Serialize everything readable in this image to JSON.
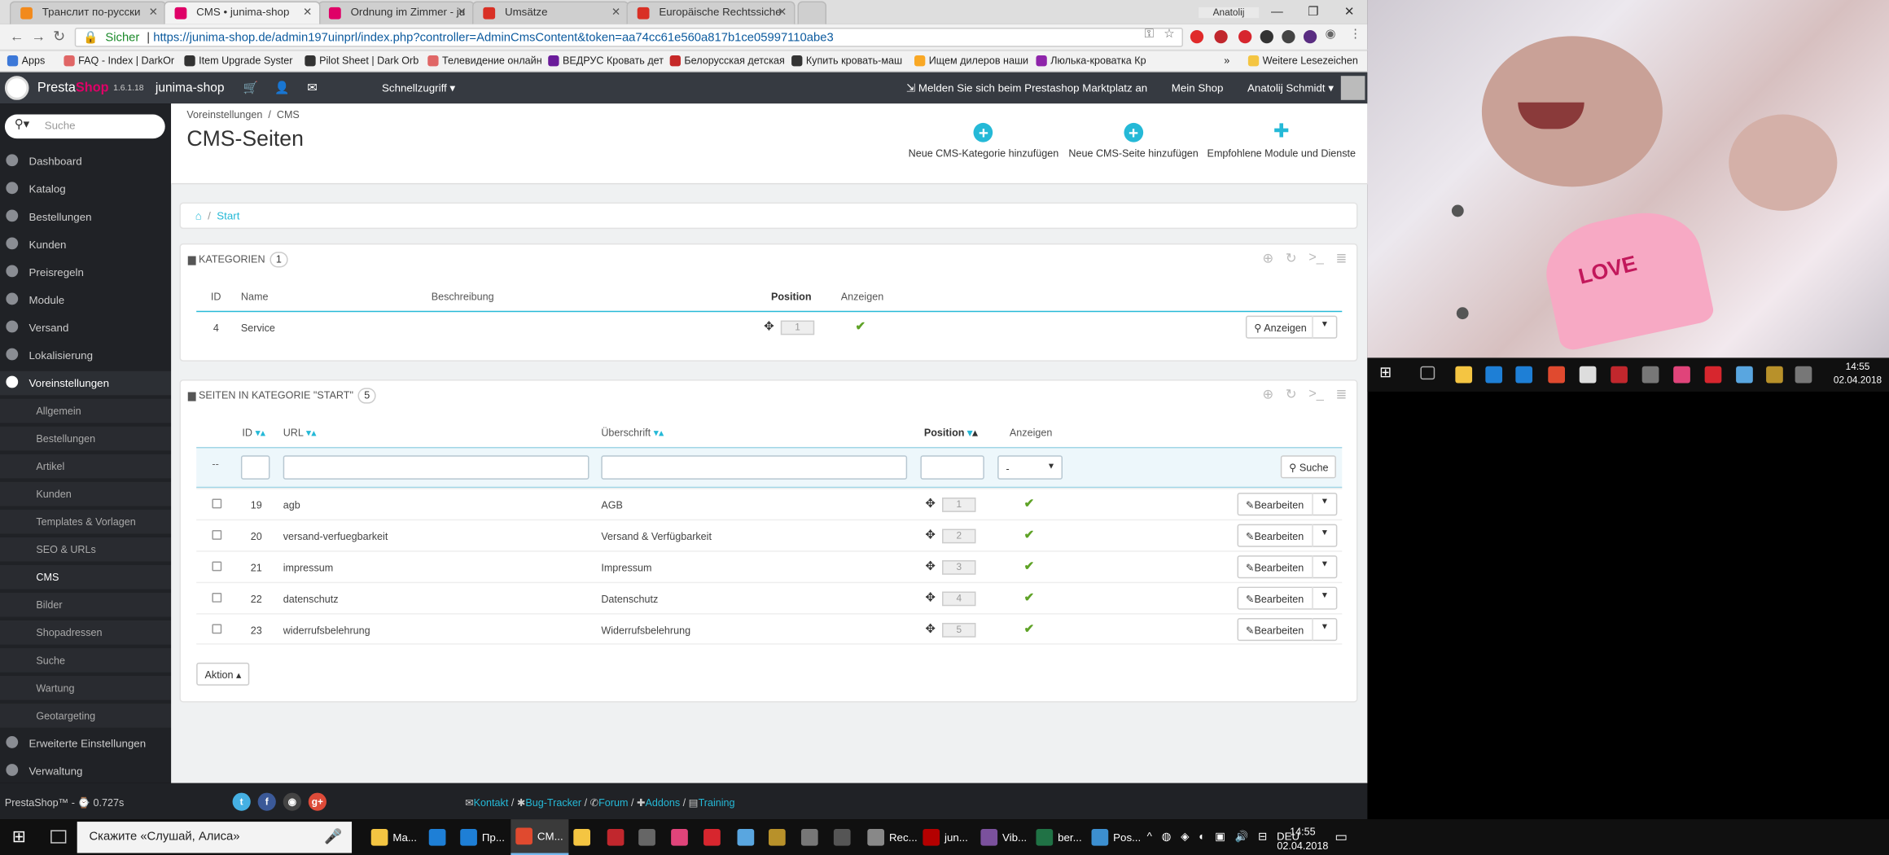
{
  "browser": {
    "tabs": [
      {
        "title": "Транслит по-русски",
        "color": "#f28a1c"
      },
      {
        "title": "CMS • junima-shop",
        "color": "#df0067"
      },
      {
        "title": "Ordnung im Zimmer - ju",
        "color": "#df0067"
      },
      {
        "title": "Umsätze",
        "color": "#d93025"
      },
      {
        "title": "Europäische Rechtssiche",
        "color": "#d93025"
      }
    ],
    "profile": "Anatolij",
    "security_label": "Sicher",
    "url": "https://junima-shop.de/admin197uinprl/index.php?controller=AdminCmsContent&token=aa74cc61e560a817b1ce05997110abe3",
    "bookmarks": [
      "Apps",
      "FAQ - Index | DarkOr",
      "Item Upgrade Syster",
      "Pilot Sheet | Dark Orb",
      "Телевидение онлайн",
      "ВЕДРУС Кровать дет",
      "Белорусская детская",
      "Купить кровать-маш",
      "Ищем дилеров наши",
      "Люлька-кроватка Кр"
    ],
    "bookmarks_more": "»",
    "other_bookmarks": "Weitere Lesezeichen"
  },
  "header": {
    "brand_a": "Presta",
    "brand_b": "Shop",
    "version": "1.6.1.18",
    "shop": "junima-shop",
    "quick_access": "Schnellzugriff ▾",
    "marketplace": "Melden Sie sich beim Prestashop Marktplatz an",
    "my_shop": "Mein Shop",
    "user": "Anatolij Schmidt ▾"
  },
  "sidebar": {
    "search_placeholder": "Suche",
    "items": [
      "Dashboard",
      "Katalog",
      "Bestellungen",
      "Kunden",
      "Preisregeln",
      "Module",
      "Versand",
      "Lokalisierung",
      "Voreinstellungen"
    ],
    "subitems": [
      "Allgemein",
      "Bestellungen",
      "Artikel",
      "Kunden",
      "Templates & Vorlagen",
      "SEO & URLs",
      "CMS",
      "Bilder",
      "Shopadressen",
      "Suche",
      "Wartung",
      "Geotargeting"
    ],
    "bottom_items": [
      "Erweiterte Einstellungen",
      "Verwaltung"
    ]
  },
  "page": {
    "breadcrumb_1": "Voreinstellungen",
    "breadcrumb_sep": "/",
    "breadcrumb_2": "CMS",
    "title": "CMS-Seiten",
    "toolbar": {
      "new_category": "Neue CMS-Kategorie hinzufügen",
      "new_page": "Neue CMS-Seite hinzufügen",
      "modules": "Empfohlene Module und Dienste"
    },
    "crumb_start": "Start"
  },
  "categories": {
    "heading": "KATEGORIEN",
    "count": "1",
    "columns": {
      "id": "ID",
      "name": "Name",
      "description": "Beschreibung",
      "position": "Position",
      "display": "Anzeigen"
    },
    "rows": [
      {
        "id": "4",
        "name": "Service",
        "position": "1",
        "action": "Anzeigen"
      }
    ]
  },
  "pages": {
    "heading": "SEITEN IN KATEGORIE \"START\"",
    "count": "5",
    "columns": {
      "id": "ID",
      "url": "URL",
      "title": "Überschrift",
      "position": "Position",
      "display": "Anzeigen"
    },
    "filter_select": "-",
    "search_button": "Suche",
    "rows": [
      {
        "id": "19",
        "url": "agb",
        "title": "AGB",
        "position": "1",
        "action": "Bearbeiten"
      },
      {
        "id": "20",
        "url": "versand-verfuegbarkeit",
        "title": "Versand & Verfügbarkeit",
        "position": "2",
        "action": "Bearbeiten"
      },
      {
        "id": "21",
        "url": "impressum",
        "title": "Impressum",
        "position": "3",
        "action": "Bearbeiten"
      },
      {
        "id": "22",
        "url": "datenschutz",
        "title": "Datenschutz",
        "position": "4",
        "action": "Bearbeiten"
      },
      {
        "id": "23",
        "url": "widerrufsbelehrung",
        "title": "Widerrufsbelehrung",
        "position": "5",
        "action": "Bearbeiten"
      }
    ],
    "bulk_action": "Aktion ▴"
  },
  "footer": {
    "brand": "PrestaShop™ - ⌚ 0.727s",
    "links": [
      "Kontakt",
      "Bug-Tracker",
      "Forum",
      "Addons",
      "Training"
    ]
  },
  "photo_text": "LOVE",
  "taskbar": {
    "cortana": "Скажите «Слушай, Алиса»",
    "apps": [
      {
        "label": "Ma...",
        "color": "#f4c542"
      },
      {
        "label": "",
        "color": "#1e7fd6"
      },
      {
        "label": "Пр...",
        "color": "#1e7fd6"
      },
      {
        "label": "CM...",
        "color": "#e04a2f"
      },
      {
        "label": "",
        "color": "#f4c542"
      },
      {
        "label": "",
        "color": "#c1272d"
      },
      {
        "label": "",
        "color": "#666"
      },
      {
        "label": "",
        "color": "#e0447a"
      },
      {
        "label": "",
        "color": "#d7262e"
      },
      {
        "label": "",
        "color": "#59a6e0"
      },
      {
        "label": "",
        "color": "#b8912a"
      },
      {
        "label": "",
        "color": "#777"
      },
      {
        "label": "",
        "color": "#555"
      },
      {
        "label": "Rec...",
        "color": "#888"
      },
      {
        "label": "jun...",
        "color": "#b40000"
      },
      {
        "label": "Vib...",
        "color": "#7b519d"
      },
      {
        "label": "ber...",
        "color": "#207245"
      },
      {
        "label": "Pos...",
        "color": "#3c8fd0"
      }
    ],
    "lang": "DEU",
    "time": "14:55",
    "date": "02.04.2018"
  },
  "taskbar_right": {
    "time": "14:55",
    "date": "02.04.2018"
  }
}
